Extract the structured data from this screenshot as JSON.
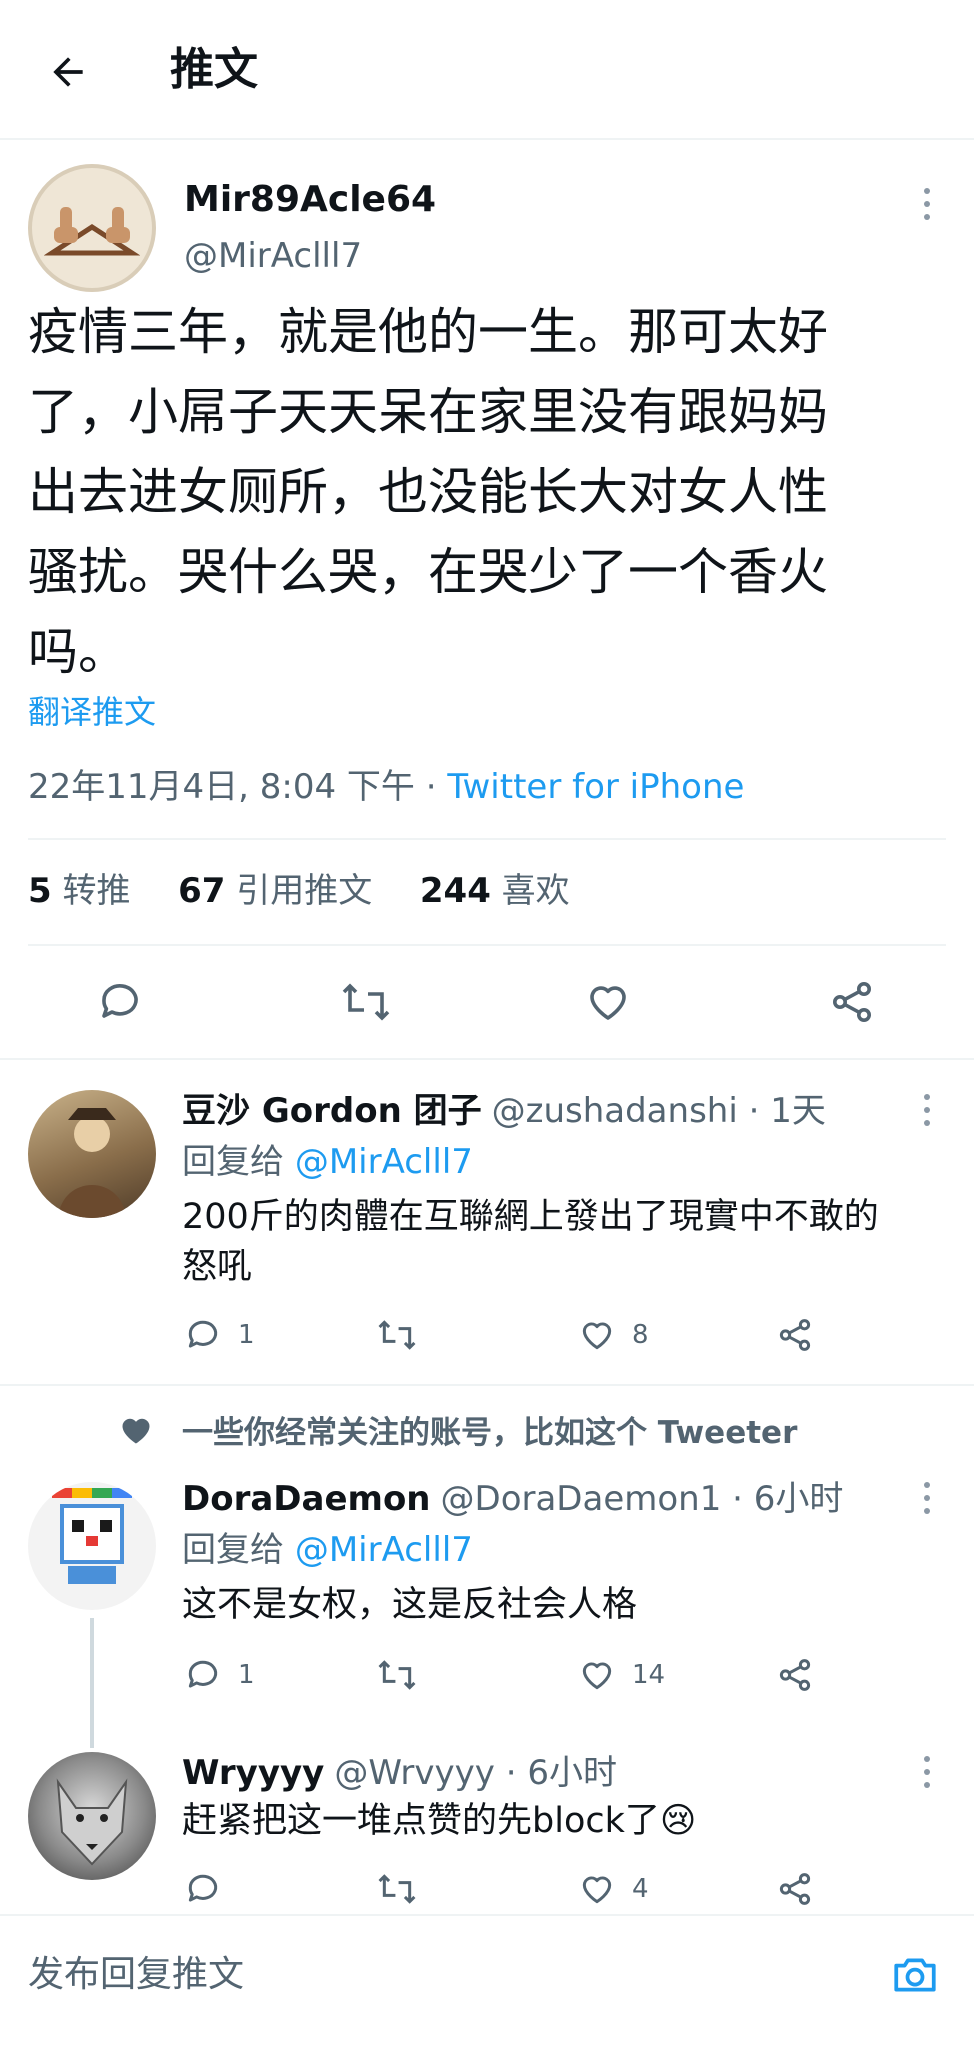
{
  "header": {
    "title": "推文"
  },
  "main_tweet": {
    "display_name": "Mir89Acle64",
    "handle": "@MirAclll7",
    "text_lines": [
      "疫情三年，就是他的一生。那可太好",
      "了，小屌子天天呆在家里没有跟妈妈",
      "出去进女厕所，也没能长大对女人性",
      "骚扰。哭什么哭，在哭少了一个香火",
      "吗。"
    ],
    "translate_label": "翻译推文",
    "timestamp": "22年11月4日, 8:04 下午 · ",
    "source": "Twitter for iPhone",
    "stats": {
      "retweets_count": "5",
      "retweets_label": "转推",
      "quotes_count": "67",
      "quotes_label": "引用推文",
      "likes_count": "244",
      "likes_label": "喜欢"
    },
    "icons": [
      "reply-icon",
      "retweet-icon",
      "like-icon",
      "share-icon"
    ]
  },
  "replies": [
    {
      "display_name": "豆沙 Gordon 团子",
      "handle": "@zushadanshi",
      "time": " · 1天",
      "reply_to_label": "回复给",
      "reply_to_handle": "@MirAclll7",
      "text_lines": [
        "200斤的肉體在互聯網上發出了現實中不敢的",
        "怒吼"
      ],
      "reply_count": "1",
      "retweet_count": "",
      "like_count": "8"
    },
    {
      "display_name": "DoraDaemon",
      "handle": "@DoraDaemon1",
      "time": " · 6小时",
      "reply_to_label": "回复给",
      "reply_to_handle": "@MirAclll7",
      "text_lines": [
        "这不是女权，这是反社会人格"
      ],
      "reply_count": "1",
      "retweet_count": "",
      "like_count": "14"
    },
    {
      "display_name": "Wryyyy",
      "handle": "@Wrvyyy",
      "time": " · 6小时",
      "text_lines": [
        "赶紧把这一堆点赞的先block了"
      ],
      "emoji": "😢",
      "reply_count": "",
      "retweet_count": "",
      "like_count": "4"
    }
  ],
  "context_note": {
    "icon": "heart-icon",
    "text": "一些你经常关注的账号，比如这个 Tweeter"
  },
  "compose": {
    "placeholder": "发布回复推文",
    "icon": "camera-icon"
  },
  "colors": {
    "accent": "#1d9bf0",
    "muted": "#536471",
    "divider": "#eff3f4"
  }
}
